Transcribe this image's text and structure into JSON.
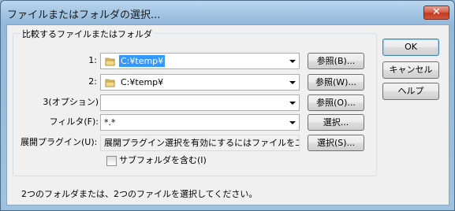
{
  "window": {
    "title": "ファイルまたはフォルダの選択...",
    "close_label": "✕"
  },
  "group": {
    "label": "比較するファイルまたはフォルダ"
  },
  "rows": {
    "left": {
      "label": "1:",
      "value": "C:¥temp¥",
      "browse_label": "参照(B)..."
    },
    "right": {
      "label": "2:",
      "value": "C:¥temp¥",
      "browse_label": "参照(W)..."
    },
    "middle": {
      "label": "3(オプション)",
      "value": "",
      "browse_label": "参照(O)..."
    },
    "filter": {
      "label": "フィルタ(F):",
      "value": "*.*",
      "select_label": "選択..."
    },
    "plugin": {
      "label": "展開プラグイン(U):",
      "value": "展開プラグイン選択を有効にするにはファイルを二つ選",
      "select_label": "選択(S)..."
    }
  },
  "checkbox": {
    "label": "サブフォルダを含む(I)",
    "checked": false
  },
  "buttons": {
    "ok": "OK",
    "cancel": "キャンセル",
    "help": "ヘルプ"
  },
  "status": "2つのフォルダまたは、2つのファイルを選択してください。",
  "colors": {
    "selection": "#3399ff",
    "close_button": "#c0391f",
    "frame": "#9fc2e1"
  },
  "icons": {
    "folder": "folder-icon",
    "dropdown": "chevron-down-icon",
    "close": "close-icon"
  }
}
